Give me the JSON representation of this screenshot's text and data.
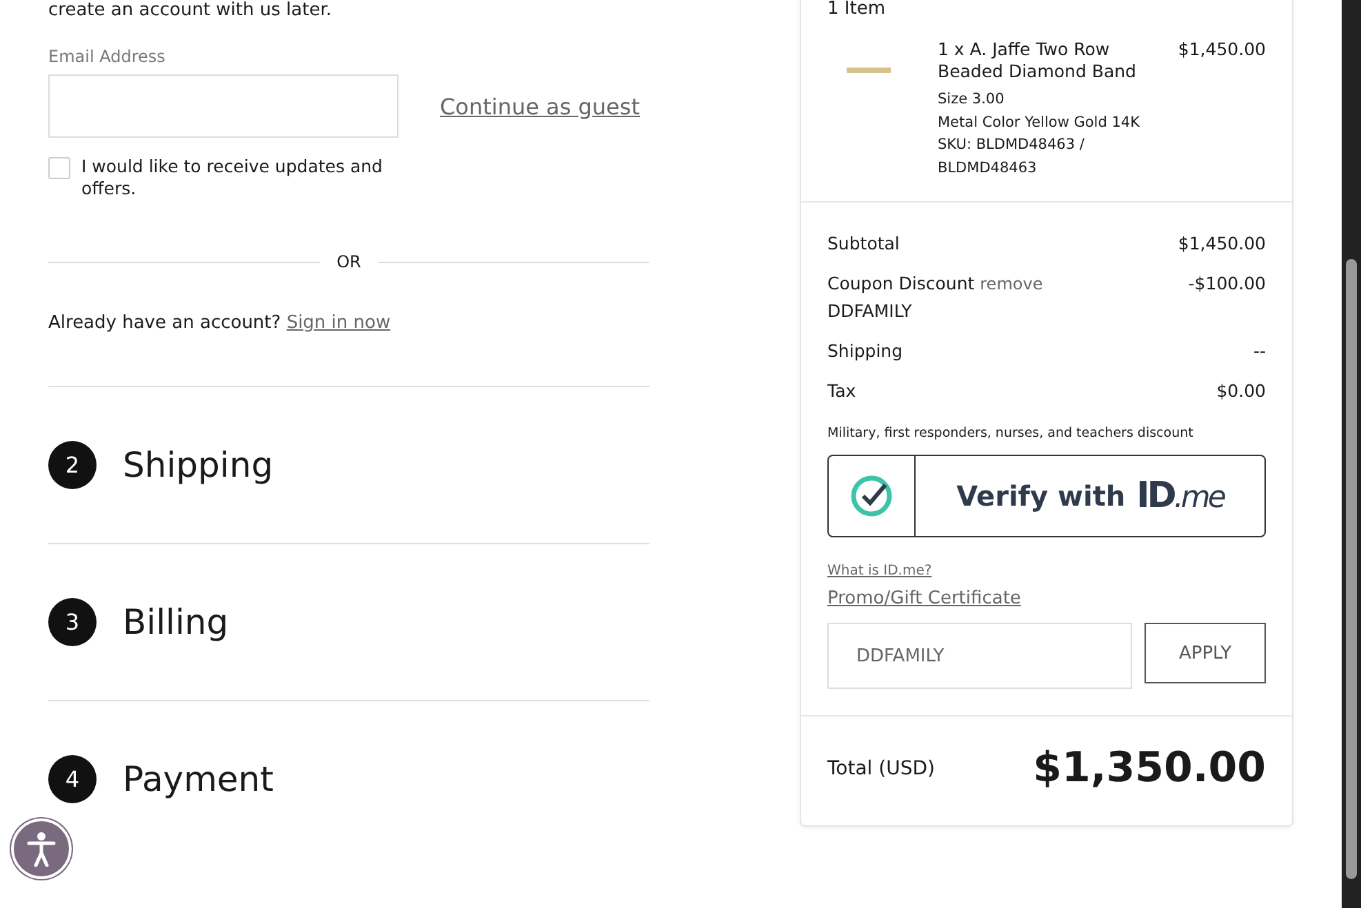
{
  "intro": "create an account with us later.",
  "email": {
    "label": "Email Address"
  },
  "guest_link": "Continue as guest",
  "updates": {
    "label": "I would like to receive updates and offers.",
    "checked": false
  },
  "divider": "OR",
  "signin": {
    "prompt": "Already have an account?",
    "link": "Sign in now"
  },
  "steps": [
    {
      "number": "2",
      "title": "Shipping"
    },
    {
      "number": "3",
      "title": "Billing"
    },
    {
      "number": "4",
      "title": "Payment"
    }
  ],
  "summary": {
    "count": "1 Item",
    "items": [
      {
        "name": "1 x A. Jaffe Two Row Beaded Diamond Band",
        "price": "$1,450.00",
        "details": [
          "Size 3.00",
          "Metal Color Yellow Gold 14K",
          "SKU: BLDMD48463 / BLDMD48463"
        ]
      }
    ],
    "lines": [
      {
        "label": "Subtotal",
        "value": "$1,450.00"
      },
      {
        "label": "Coupon Discount",
        "action": "remove",
        "code": "DDFAMILY",
        "value": "-$100.00"
      },
      {
        "label": "Shipping",
        "value": "--"
      },
      {
        "label": "Tax",
        "value": "$0.00"
      }
    ],
    "discount_note": "Military, first responders, nurses, and teachers discount",
    "verify": {
      "label": "Verify with",
      "brand": "ID",
      "brand_suffix": ".me"
    },
    "what_is": "What is ID.me?",
    "promo_link": "Promo/Gift Certificate",
    "promo_field": {
      "value": "DDFAMILY"
    },
    "apply": "APPLY",
    "total_label": "Total (USD)",
    "total": "$1,350.00"
  }
}
